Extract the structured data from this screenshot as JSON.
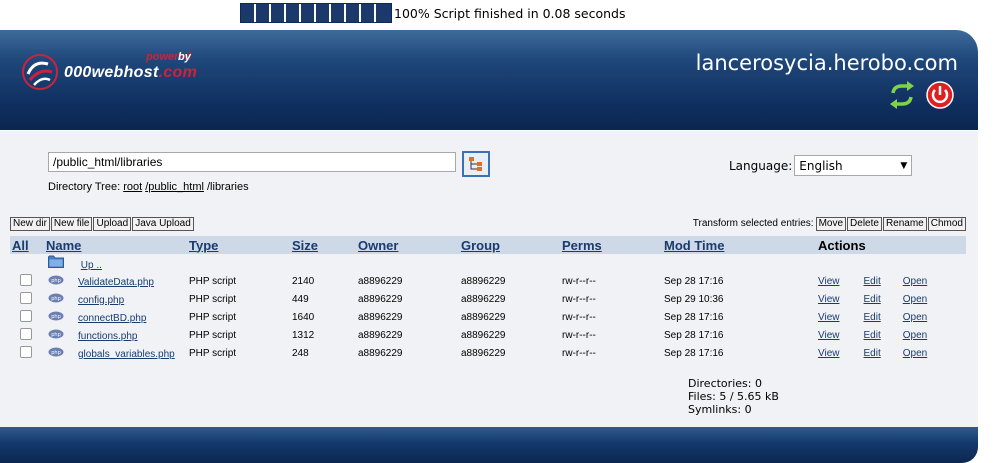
{
  "progress": {
    "text": "100% Script finished in 0.08 seconds",
    "blocks": 10
  },
  "header": {
    "logo": {
      "powered": "powered",
      "by": "by",
      "brand_main": "000webhost",
      "brand_suffix": ".com"
    },
    "host": "lancerosycia.herobo.com",
    "icons": [
      "refresh-icon",
      "power-icon"
    ]
  },
  "navigation": {
    "path_value": "/public_html/libraries",
    "tree_label": "Directory Tree:",
    "crumbs": [
      "root",
      "/public_html",
      "/libraries"
    ]
  },
  "language": {
    "label": "Language:",
    "selected": "English"
  },
  "toolbar": {
    "new_dir": "New dir",
    "new_file": "New file",
    "upload": "Upload",
    "java_upload": "Java Upload",
    "transform_label": "Transform selected entries:",
    "move": "Move",
    "delete": "Delete",
    "rename": "Rename",
    "chmod": "Chmod"
  },
  "table": {
    "headers": {
      "all": "All",
      "name": "Name",
      "type": "Type",
      "size": "Size",
      "owner": "Owner",
      "group": "Group",
      "perms": "Perms",
      "mtime": "Mod Time",
      "actions": "Actions"
    },
    "up_label": "Up ..",
    "rows": [
      {
        "name": "ValidateData.php",
        "type": "PHP script",
        "size": "2140",
        "owner": "a8896229",
        "group": "a8896229",
        "perms": "rw-r--r--",
        "mtime": "Sep 28 17:16"
      },
      {
        "name": "config.php",
        "type": "PHP script",
        "size": "449",
        "owner": "a8896229",
        "group": "a8896229",
        "perms": "rw-r--r--",
        "mtime": "Sep 29 10:36"
      },
      {
        "name": "connectBD.php",
        "type": "PHP script",
        "size": "1640",
        "owner": "a8896229",
        "group": "a8896229",
        "perms": "rw-r--r--",
        "mtime": "Sep 28 17:16"
      },
      {
        "name": "functions.php",
        "type": "PHP script",
        "size": "1312",
        "owner": "a8896229",
        "group": "a8896229",
        "perms": "rw-r--r--",
        "mtime": "Sep 28 17:16"
      },
      {
        "name": "globals_variables.php",
        "type": "PHP script",
        "size": "248",
        "owner": "a8896229",
        "group": "a8896229",
        "perms": "rw-r--r--",
        "mtime": "Sep 28 17:16"
      }
    ],
    "actions": {
      "view": "View",
      "edit": "Edit",
      "open": "Open"
    }
  },
  "summary": {
    "directories": "Directories: 0",
    "files": "Files: 5 / 5.65 kB",
    "symlinks": "Symlinks: 0"
  },
  "colors": {
    "header_dark": "#0b2750",
    "header_light": "#3e6b9a",
    "accent_red": "#d0213c",
    "link": "#1a3b6e",
    "table_header": "#cdd9e6"
  }
}
